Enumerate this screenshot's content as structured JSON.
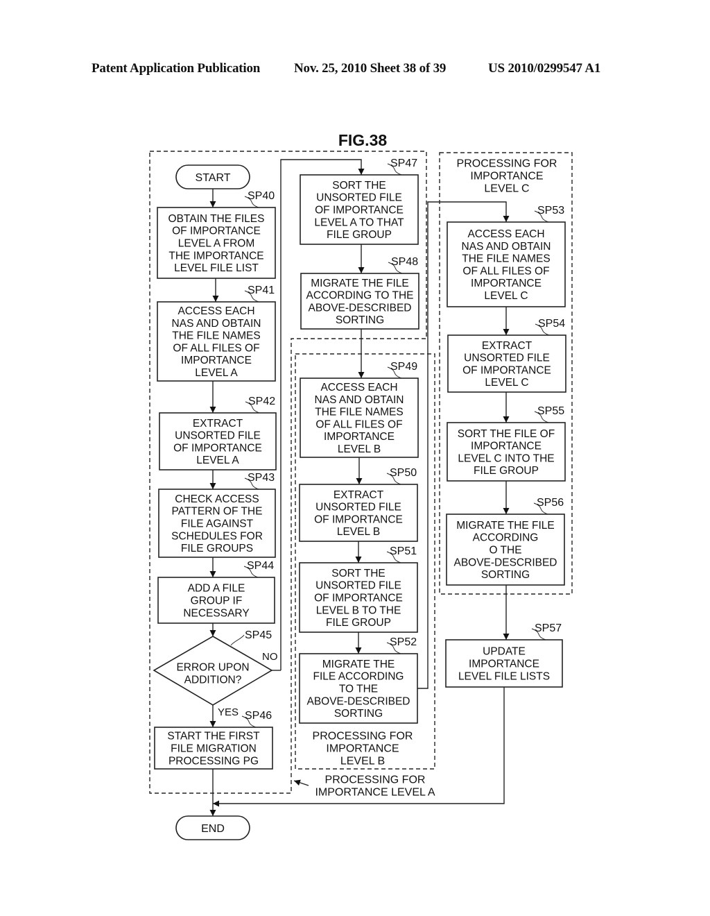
{
  "header": {
    "publication": "Patent Application Publication",
    "date_sheet": "Nov. 25, 2010  Sheet 38 of 39",
    "patent_number": "US 2010/0299547 A1"
  },
  "figure": {
    "title": "FIG.38",
    "start_label": "START",
    "end_label": "END",
    "regions": {
      "level_a": [
        "PROCESSING FOR",
        "IMPORTANCE LEVEL A"
      ],
      "level_b": [
        "PROCESSING FOR",
        "IMPORTANCE",
        "LEVEL B"
      ],
      "level_c": [
        "PROCESSING FOR",
        "IMPORTANCE",
        "LEVEL C"
      ]
    },
    "decision": {
      "step": "SP45",
      "lines": [
        "ERROR UPON",
        "ADDITION?"
      ],
      "yes_label": "YES",
      "no_label": "NO"
    },
    "steps": [
      {
        "id": "SP40",
        "lines": [
          "OBTAIN THE FILES",
          "OF IMPORTANCE",
          "LEVEL A FROM",
          "THE IMPORTANCE",
          "LEVEL FILE LIST"
        ]
      },
      {
        "id": "SP41",
        "lines": [
          "ACCESS EACH",
          "NAS AND OBTAIN",
          "THE FILE NAMES",
          "OF ALL FILES OF",
          "IMPORTANCE",
          "LEVEL A"
        ]
      },
      {
        "id": "SP42",
        "lines": [
          "EXTRACT",
          "UNSORTED FILE",
          "OF IMPORTANCE",
          "LEVEL A"
        ]
      },
      {
        "id": "SP43",
        "lines": [
          "CHECK ACCESS",
          "PATTERN OF THE",
          "FILE AGAINST",
          "SCHEDULES FOR",
          "FILE GROUPS"
        ]
      },
      {
        "id": "SP44",
        "lines": [
          "ADD A FILE",
          "GROUP IF",
          "NECESSARY"
        ]
      },
      {
        "id": "SP46",
        "lines": [
          "START THE FIRST",
          "FILE MIGRATION",
          "PROCESSING PG"
        ]
      },
      {
        "id": "SP47",
        "lines": [
          "SORT THE",
          "UNSORTED FILE",
          "OF IMPORTANCE",
          "LEVEL A TO THAT",
          "FILE GROUP"
        ]
      },
      {
        "id": "SP48",
        "lines": [
          "MIGRATE THE FILE",
          "ACCORDING TO THE",
          "ABOVE-DESCRIBED",
          "SORTING"
        ]
      },
      {
        "id": "SP49",
        "lines": [
          "ACCESS EACH",
          "NAS AND OBTAIN",
          "THE FILE NAMES",
          "OF ALL FILES OF",
          "IMPORTANCE",
          "LEVEL B"
        ]
      },
      {
        "id": "SP50",
        "lines": [
          "EXTRACT",
          "UNSORTED FILE",
          "OF IMPORTANCE",
          "LEVEL B"
        ]
      },
      {
        "id": "SP51",
        "lines": [
          "SORT THE",
          "UNSORTED FILE",
          "OF IMPORTANCE",
          "LEVEL B TO THE",
          "FILE GROUP"
        ]
      },
      {
        "id": "SP52",
        "lines": [
          "MIGRATE THE",
          "FILE ACCORDING",
          "TO THE",
          "ABOVE-DESCRIBED",
          "SORTING"
        ]
      },
      {
        "id": "SP53",
        "lines": [
          "ACCESS EACH",
          "NAS AND OBTAIN",
          "THE FILE NAMES",
          "OF ALL FILES OF",
          "IMPORTANCE",
          "LEVEL C"
        ]
      },
      {
        "id": "SP54",
        "lines": [
          "EXTRACT",
          "UNSORTED FILE",
          "OF IMPORTANCE",
          "LEVEL C"
        ]
      },
      {
        "id": "SP55",
        "lines": [
          "SORT THE FILE OF",
          "IMPORTANCE",
          "LEVEL C INTO THE",
          "FILE GROUP"
        ]
      },
      {
        "id": "SP56",
        "lines": [
          "MIGRATE THE FILE",
          "ACCORDING",
          "O THE",
          "ABOVE-DESCRIBED",
          "SORTING"
        ]
      },
      {
        "id": "SP57",
        "lines": [
          "UPDATE",
          "IMPORTANCE",
          "LEVEL FILE LISTS"
        ]
      }
    ]
  }
}
